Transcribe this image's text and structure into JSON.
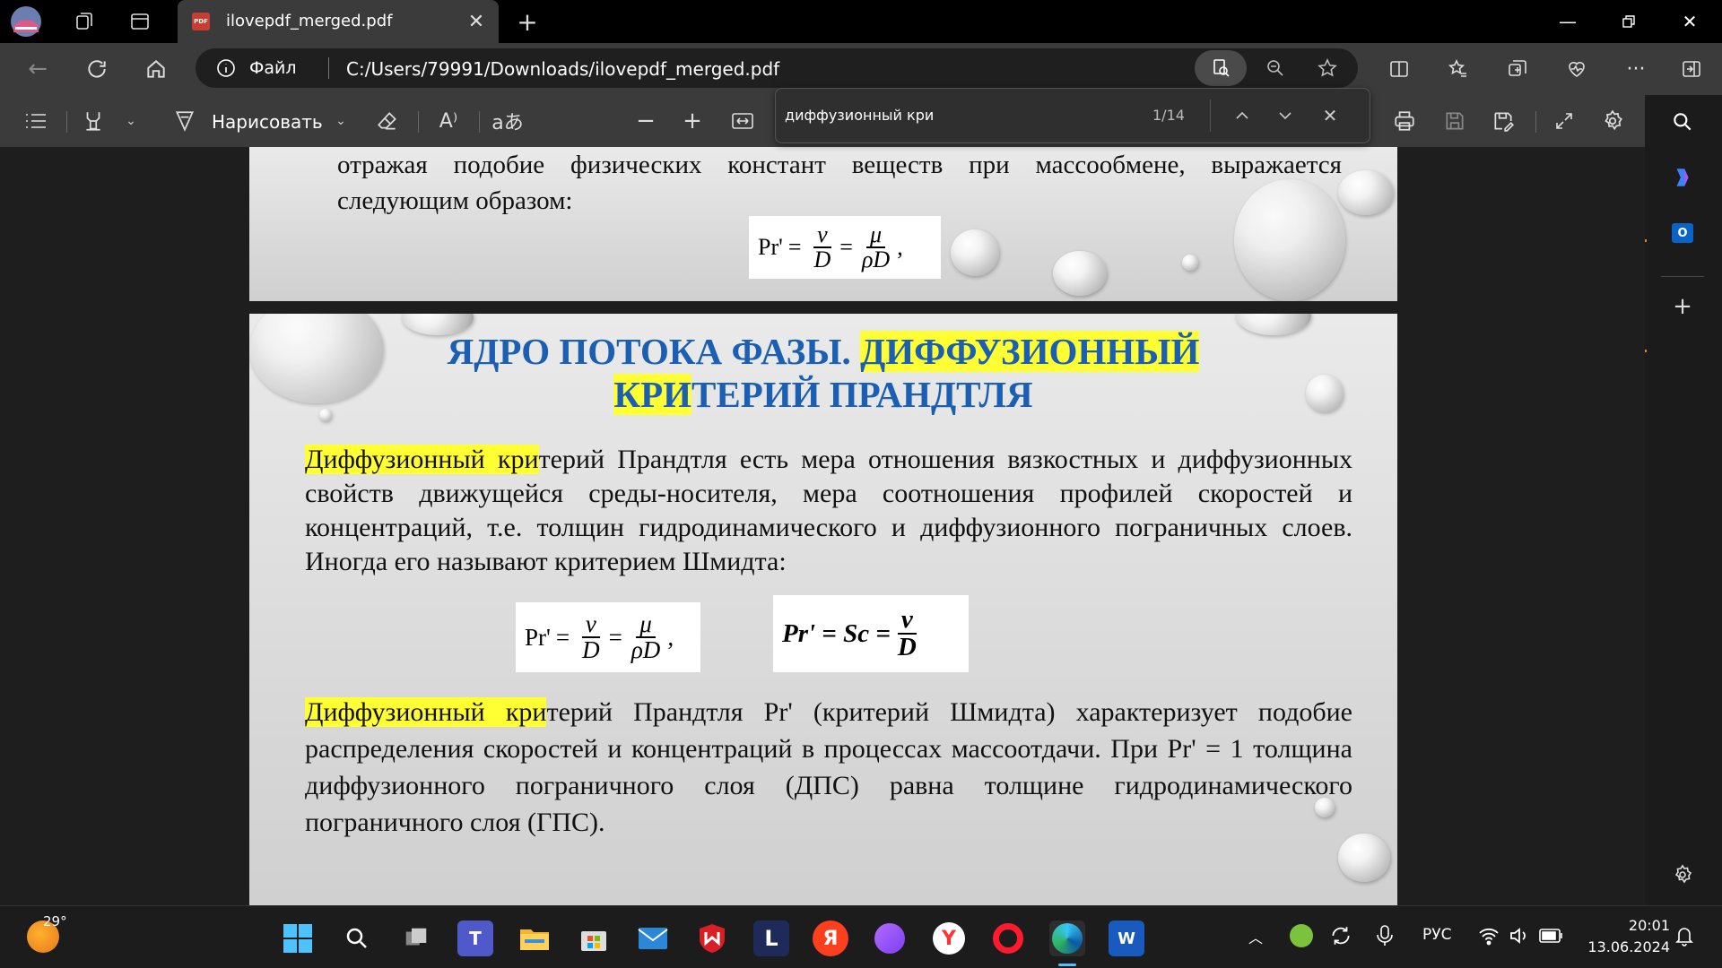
{
  "tab": {
    "title": "ilovepdf_merged.pdf",
    "pdf_badge": "PDF"
  },
  "address": {
    "scheme_label": "Файл",
    "url": "C:/Users/79991/Downloads/ilovepdf_merged.pdf"
  },
  "toolbar": {
    "draw_label": "Нарисовать"
  },
  "find": {
    "query": "диффузионный кри",
    "count": "1/14"
  },
  "slide1": {
    "line1": "отражая подобие физических констант веществ при массообмене, выражается",
    "line2": "следующим образом:",
    "formula": {
      "lhs": "Pr'",
      "eq": "=",
      "n1": "ν",
      "d1": "D",
      "n2": "μ",
      "d2": "ρD",
      "comma": ","
    }
  },
  "slide2": {
    "title_a": "ЯДРО ПОТОКА ФАЗЫ. ",
    "title_b": "ДИФФУЗИОННЫЙ",
    "title_c": "КРИ",
    "title_d": "ТЕРИЙ ПРАНДТЛЯ",
    "p1_hl": "Диффузионный кри",
    "p1_rest": "терий Прандтля есть мера отношения вязкостных и диффузионных свойств движущейся среды-носителя, мера соотношения профилей скоростей и концентраций, т.е. толщин гидродинамического и диффузионного пограничных слоев. Иногда его называют критерием Шмидта:",
    "f1": {
      "lhs": "Pr'",
      "eq": "=",
      "n1": "ν",
      "d1": "D",
      "n2": "μ",
      "d2": "ρD",
      "comma": ","
    },
    "f2": {
      "lhs": "Pr' = Sc =",
      "num": "ν",
      "den": "D"
    },
    "p2_hl": "Диффузионный кри",
    "p2_rest": "терий Прандтля Pr' (критерий Шмидта) характеризует подобие распределения скоростей и концентраций в процессах массоотдачи. При Pr' = 1 толщина диффузионного пограничного слоя (ДПС) равна толщине гидродинамического пограничного слоя (ГПС)."
  },
  "taskbar": {
    "weather_temp": "29°",
    "lang": "РУС",
    "time": "20:01",
    "date": "13.06.2024",
    "apps": [
      "windows-start",
      "search",
      "task-view",
      "teams",
      "file-explorer",
      "microsoft-store",
      "mail",
      "kaspersky",
      "lingualeo",
      "yandex",
      "alice",
      "yandex-browser",
      "opera",
      "edge",
      "word"
    ]
  },
  "colors": {
    "title_blue": "#1a5fb4",
    "highlight": "#ffff33",
    "toolbar_bg": "#3b3b3b"
  }
}
